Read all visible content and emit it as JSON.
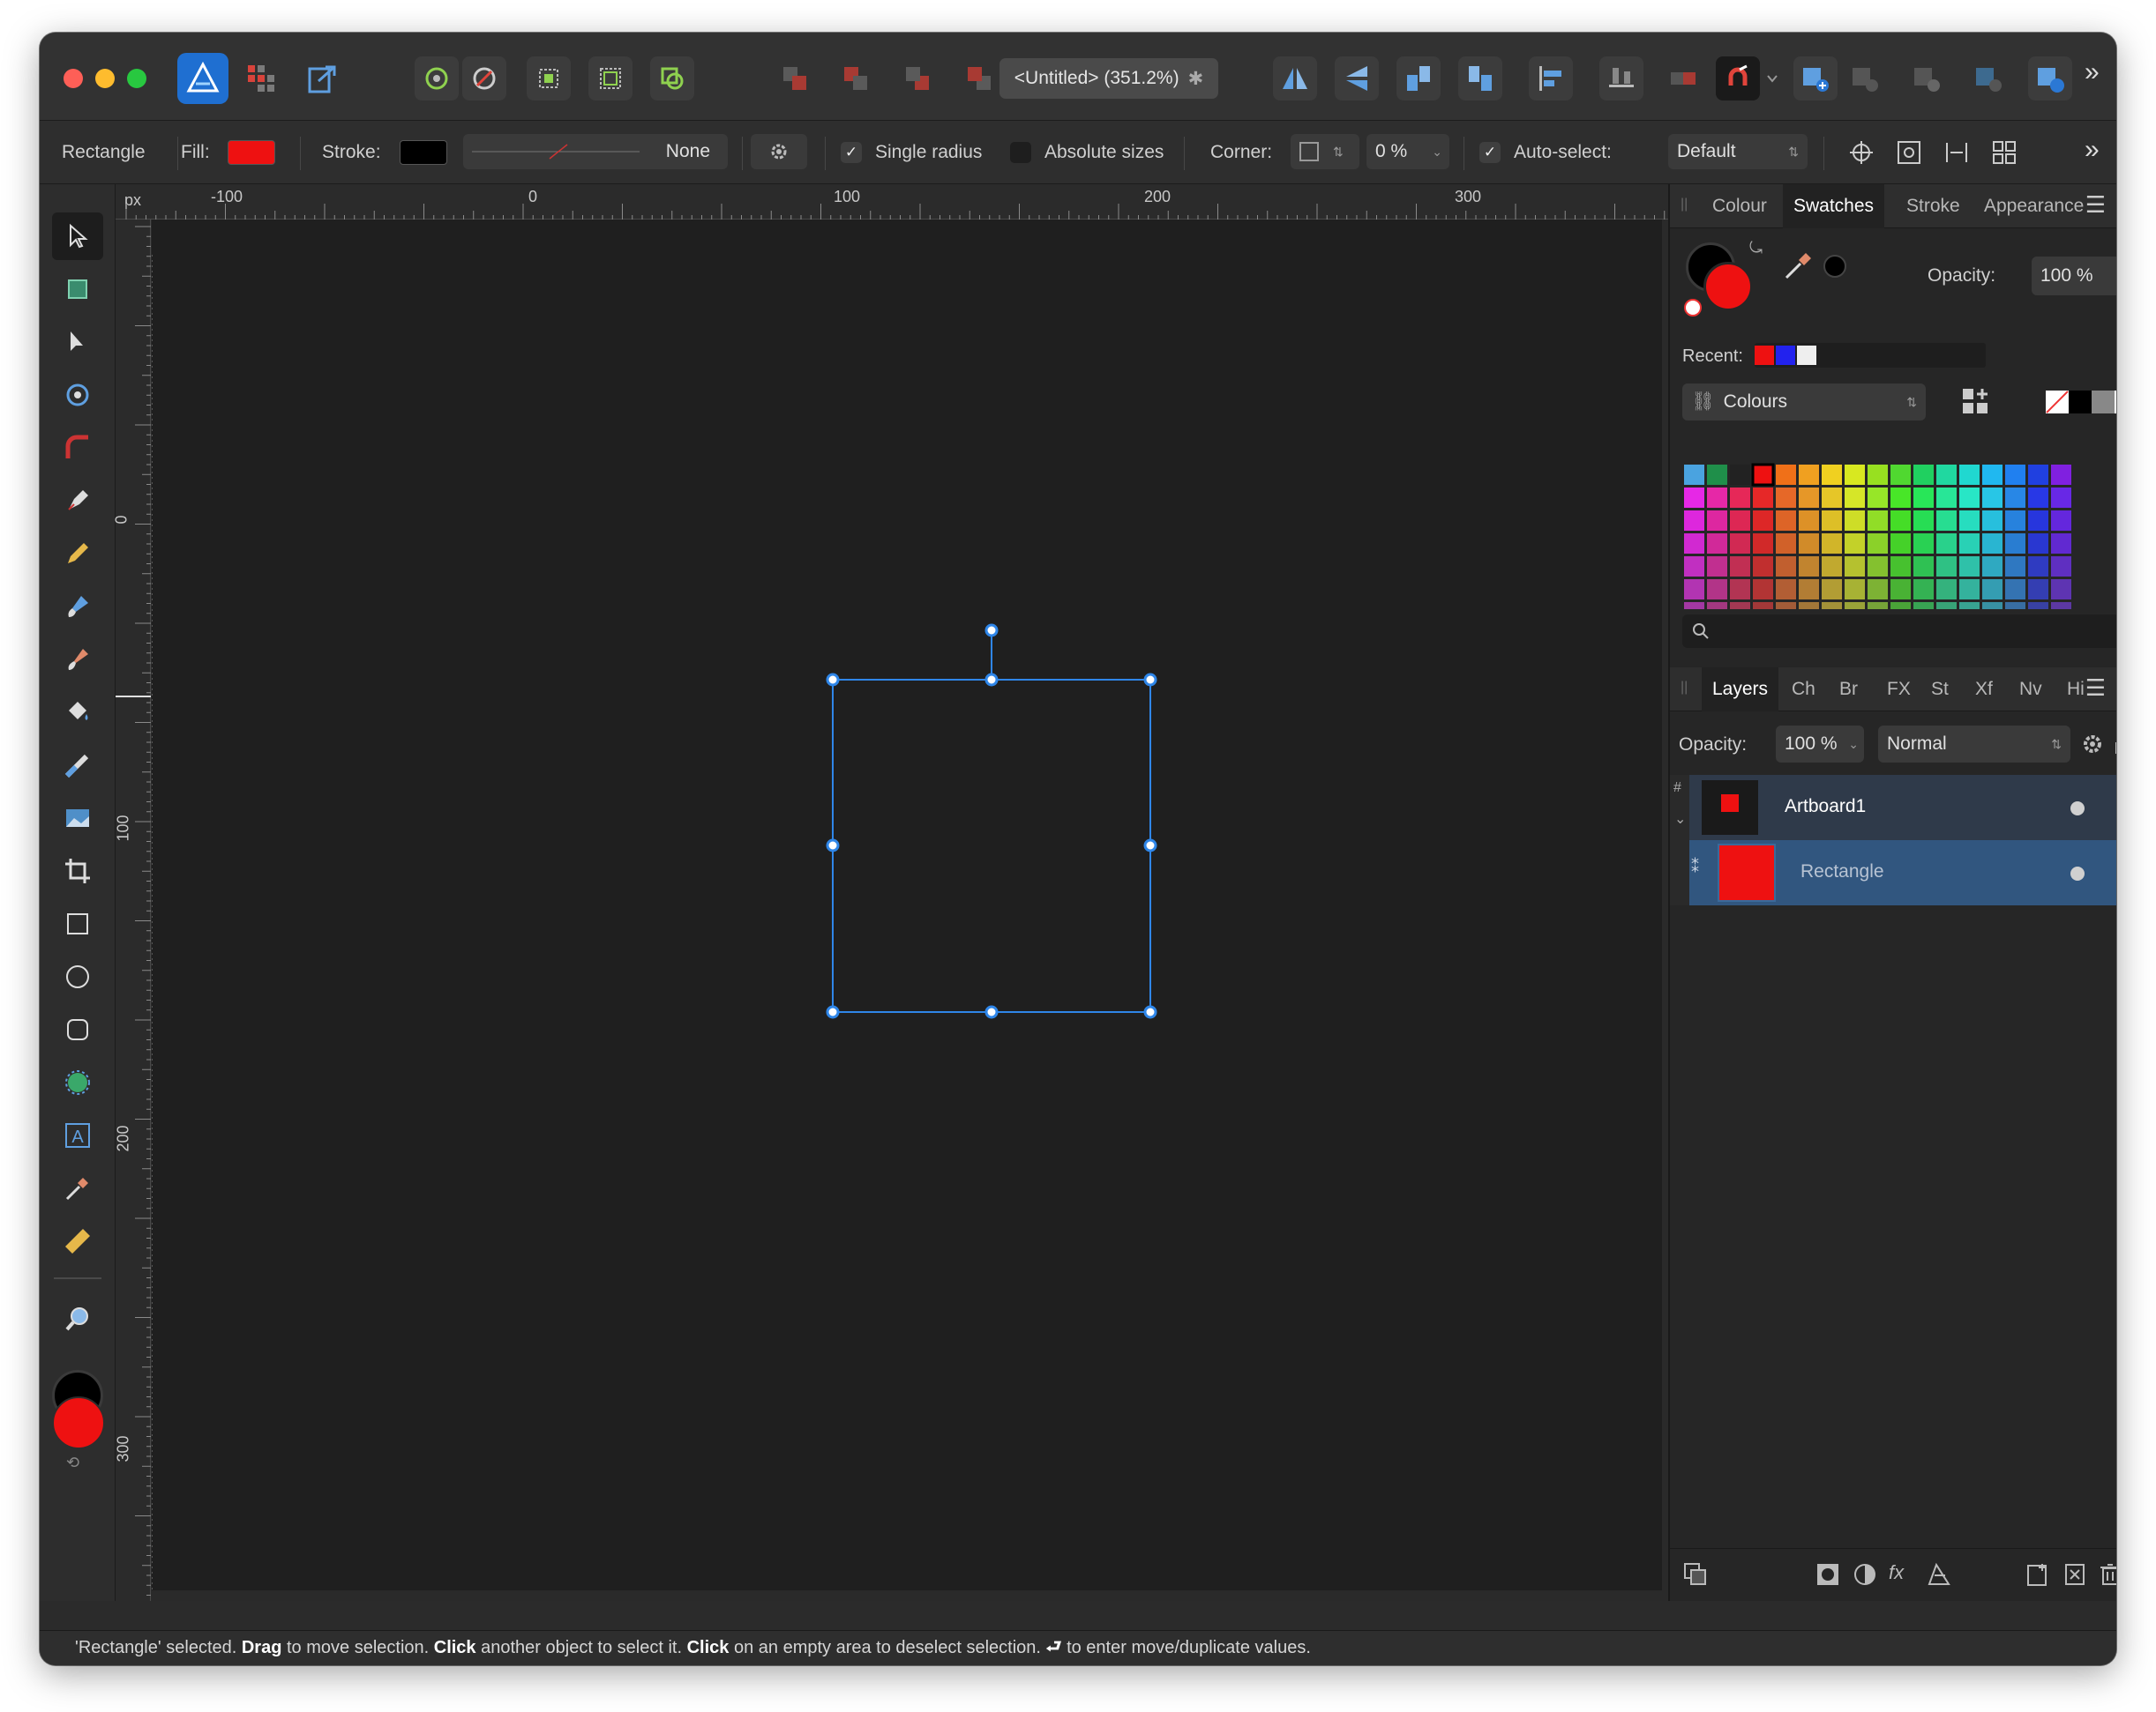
{
  "app": {
    "document_title": "<Untitled> (351.2%)",
    "close_glyph": "✱",
    "overflow_glyph": "»"
  },
  "context_toolbar": {
    "tool_name": "Rectangle",
    "fill_label": "Fill:",
    "fill_color": "#ee1111",
    "stroke_label": "Stroke:",
    "stroke_color": "#000000",
    "stroke_style_value": "None",
    "single_radius_label": "Single radius",
    "single_radius_checked": true,
    "absolute_sizes_label": "Absolute sizes",
    "absolute_sizes_checked": false,
    "corner_label": "Corner:",
    "corner_value": "0 %",
    "auto_select_label": "Auto-select:",
    "auto_select_checked": true,
    "auto_select_value": "Default"
  },
  "rulers": {
    "unit": "px",
    "top_labels": [
      "-100",
      "0",
      "100",
      "200",
      "300"
    ],
    "left_labels": [
      "0",
      "100",
      "200",
      "300"
    ]
  },
  "colour_panel": {
    "tabs": [
      "Colour",
      "Swatches",
      "Stroke",
      "Appearance"
    ],
    "active_tab": "Swatches",
    "fill_color": "#ee1111",
    "stroke_color": "#000000",
    "opacity_label": "Opacity:",
    "opacity_value": "100 %",
    "recent_label": "Recent:",
    "recent_colors": [
      "#ee1111",
      "#2222ee",
      "#eeeeee"
    ],
    "palette_name": "Colours",
    "search_placeholder": ""
  },
  "layers_panel": {
    "tabs": [
      "Layers",
      "Ch",
      "Br",
      "FX",
      "St",
      "Xf",
      "Nv",
      "Hi"
    ],
    "active_tab": "Layers",
    "opacity_label": "Opacity:",
    "opacity_value": "100 %",
    "blend_mode": "Normal",
    "layers": [
      {
        "name": "Artboard1",
        "color": "#ee1111"
      },
      {
        "name": "Rectangle",
        "color": "#ee1111"
      }
    ]
  },
  "tools_panel": {
    "fill_color": "#ee1111",
    "stroke_color": "#000000"
  },
  "status": {
    "part1": "'Rectangle' selected. ",
    "drag": "Drag",
    "part2": " to move selection. ",
    "click1": "Click",
    "part3": " another object to select it. ",
    "click2": "Click",
    "part4": " on an empty area to deselect selection. ",
    "enter_glyph": "⮐",
    "part5": " to enter move/duplicate values."
  }
}
